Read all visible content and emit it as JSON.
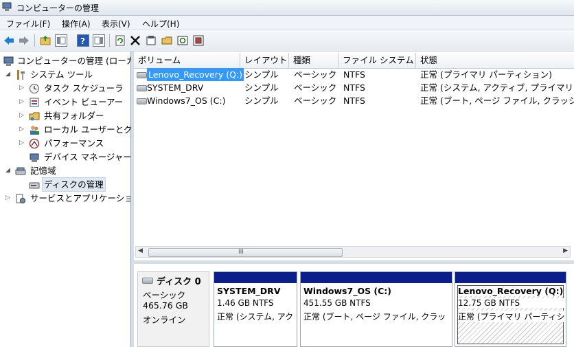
{
  "window": {
    "title": "コンピューターの管理"
  },
  "menu": [
    "ファイル(F)",
    "操作(A)",
    "表示(V)",
    "ヘルプ(H)"
  ],
  "tree": [
    {
      "label": "コンピューターの管理 (ローカ"
    },
    {
      "label": "システム ツール"
    },
    {
      "label": "タスク スケジューラ"
    },
    {
      "label": "イベント ビューアー"
    },
    {
      "label": "共有フォルダー"
    },
    {
      "label": "ローカル ユーザーとグ"
    },
    {
      "label": "パフォーマンス"
    },
    {
      "label": "デバイス マネージャー"
    },
    {
      "label": "記憶域"
    },
    {
      "label": "ディスクの管理"
    },
    {
      "label": "サービスとアプリケーショ"
    }
  ],
  "volume_list": {
    "headers": [
      "ボリューム",
      "レイアウト",
      "種類",
      "ファイル システム",
      "状態"
    ],
    "rows": [
      {
        "name": "Lenovo_Recovery (Q:)",
        "layout": "シンプル",
        "type": "ベーシック",
        "fs": "NTFS",
        "status": "正常 (プライマリ パーティション)"
      },
      {
        "name": "SYSTEM_DRV",
        "layout": "シンプル",
        "type": "ベーシック",
        "fs": "NTFS",
        "status": "正常 (システム, アクティブ, プライマリ"
      },
      {
        "name": "Windows7_OS (C:)",
        "layout": "シンプル",
        "type": "ベーシック",
        "fs": "NTFS",
        "status": "正常 (ブート, ページ ファイル, クラッシ"
      }
    ],
    "scroll_grip": "III"
  },
  "disk": {
    "title": "ディスク 0",
    "type": "ベーシック",
    "size": "465.76 GB",
    "status": "オンライン",
    "partitions": [
      {
        "name": "SYSTEM_DRV",
        "size": "1.46 GB NTFS",
        "status": "正常 (システム, アク"
      },
      {
        "name": "Windows7_OS  (C:)",
        "size": "451.55 GB NTFS",
        "status": "正常 (ブート, ページ ファイル, クラッ"
      },
      {
        "name": "Lenovo_Recovery  (Q:)",
        "size": "12.75 GB NTFS",
        "status": "正常 (プライマリ パーティシ"
      }
    ]
  },
  "colors": {
    "selection": "#3399ff",
    "partition_bar": "#0b1f8c",
    "back_icon": "#1c7fd6"
  }
}
